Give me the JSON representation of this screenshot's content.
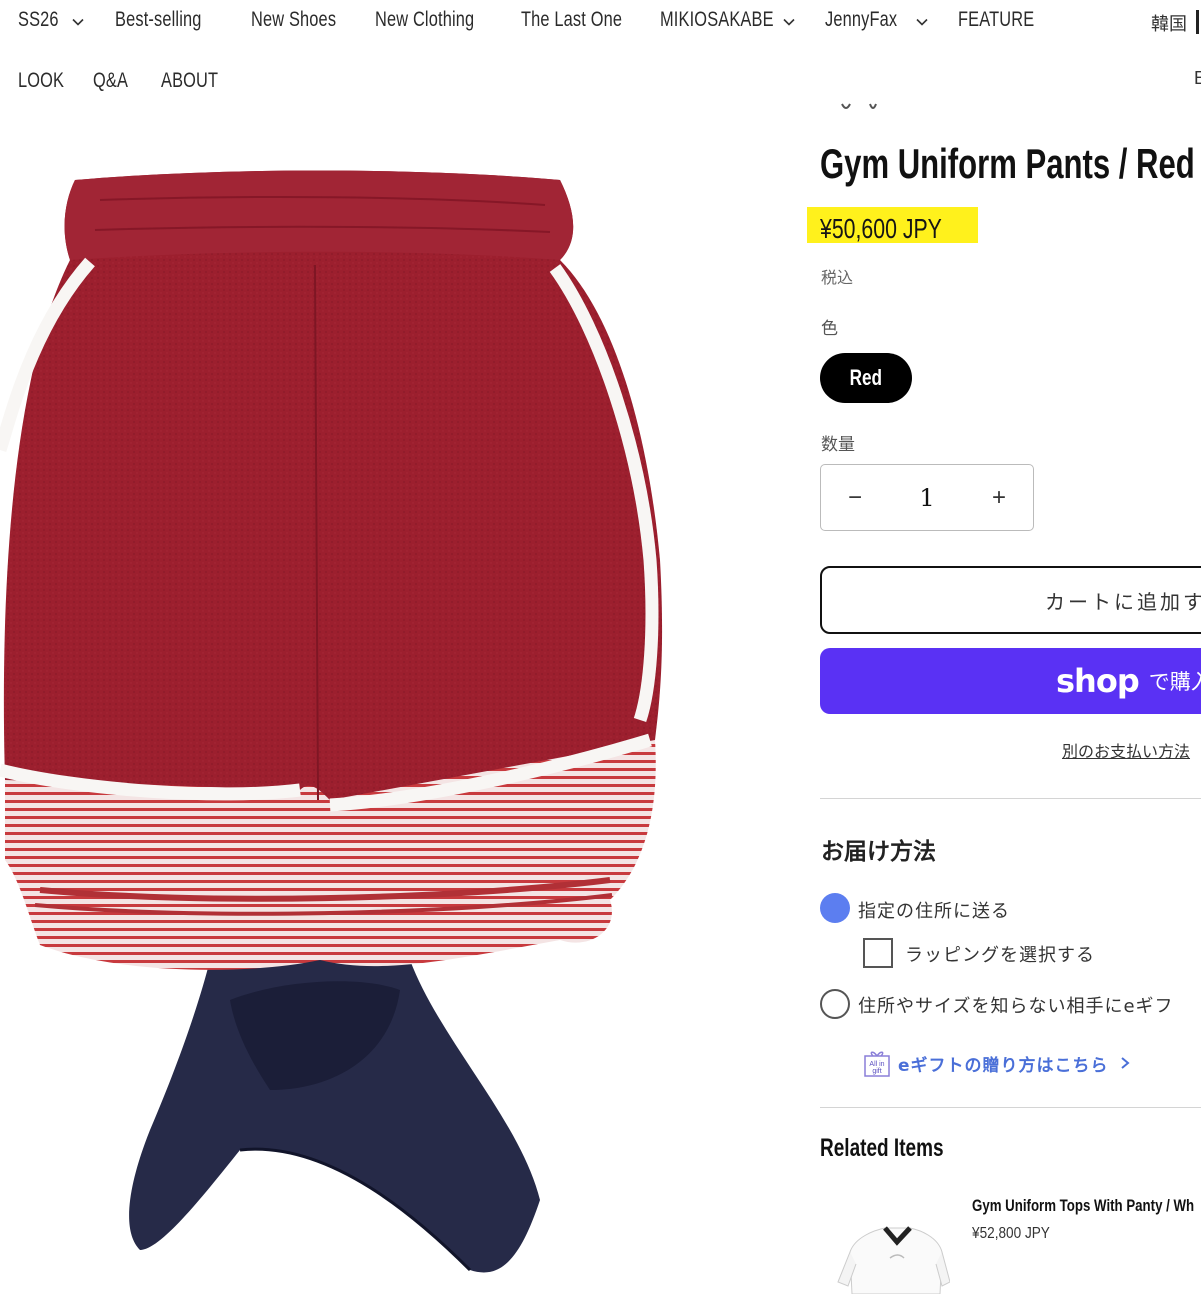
{
  "nav": {
    "row1": [
      {
        "label": "SS26",
        "has_dropdown": true
      },
      {
        "label": "Best-selling",
        "has_dropdown": false
      },
      {
        "label": "New Shoes",
        "has_dropdown": false
      },
      {
        "label": "New Clothing",
        "has_dropdown": false
      },
      {
        "label": "The Last One",
        "has_dropdown": false
      },
      {
        "label": "MIKIOSAKABE",
        "has_dropdown": true
      },
      {
        "label": "JennyFax",
        "has_dropdown": true
      },
      {
        "label": "FEATURE",
        "has_dropdown": false
      }
    ],
    "row2": [
      {
        "label": "LOOK"
      },
      {
        "label": "Q&A"
      },
      {
        "label": "ABOUT"
      }
    ],
    "language": "韓国",
    "edge_glyph": "E"
  },
  "product": {
    "title": "Gym Uniform Pants / Red",
    "price": "¥50,600 JPY",
    "price_highlight_color": "#fff11c",
    "tax_note": "税込",
    "color_label": "色",
    "selected_color": "Red",
    "quantity_label": "数量",
    "quantity": "1",
    "decrement_symbol": "−",
    "increment_symbol": "+",
    "add_to_cart": "カートに追加す",
    "shop_pay_logo": "shop",
    "shop_pay_text": "で購入",
    "shop_pay_color": "#5a31f4",
    "other_payment": "別のお支払い方法"
  },
  "delivery": {
    "heading": "お届け方法",
    "option_address": "指定の住所に送る",
    "option_wrapping": "ラッピングを選択する",
    "option_egift": "住所やサイズを知らない相手にeギフ",
    "gift_link": "eギフトの贈り方はこちら",
    "gift_icon_text": "All in gift",
    "radio_on_color": "#5c7ef0"
  },
  "related": {
    "heading": "Related Items",
    "items": [
      {
        "name": "Gym Uniform Tops With Panty / Wh",
        "price": "¥52,800 JPY"
      }
    ]
  }
}
